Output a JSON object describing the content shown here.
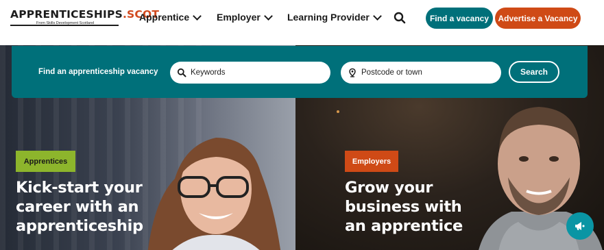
{
  "brand": {
    "logo_main": "APPRENTICESHIPS",
    "logo_suffix": ".SCOT",
    "logo_tagline": "From Skills Development Scotland",
    "accent_teal": "#00707a",
    "accent_orange": "#cf4a16",
    "accent_green": "#8db52c"
  },
  "nav": {
    "items": [
      {
        "label": "Apprentice"
      },
      {
        "label": "Employer"
      },
      {
        "label": "Learning Provider"
      }
    ],
    "search_icon": "search-icon",
    "find_vacancy": "Find a vacancy",
    "advertise_vacancy": "Advertise a Vacancy"
  },
  "search": {
    "label": "Find an apprenticeship vacancy",
    "keywords_placeholder": "Keywords",
    "postcode_placeholder": "Postcode or town",
    "button": "Search"
  },
  "hero": {
    "left": {
      "tag": "Apprentices",
      "headline_lines": [
        "Kick-start your",
        "career with an",
        "apprenticeship"
      ]
    },
    "right": {
      "tag": "Employers",
      "headline_lines": [
        "Grow your",
        "business with",
        "an apprentice"
      ]
    }
  },
  "feedback_icon": "megaphone-icon"
}
